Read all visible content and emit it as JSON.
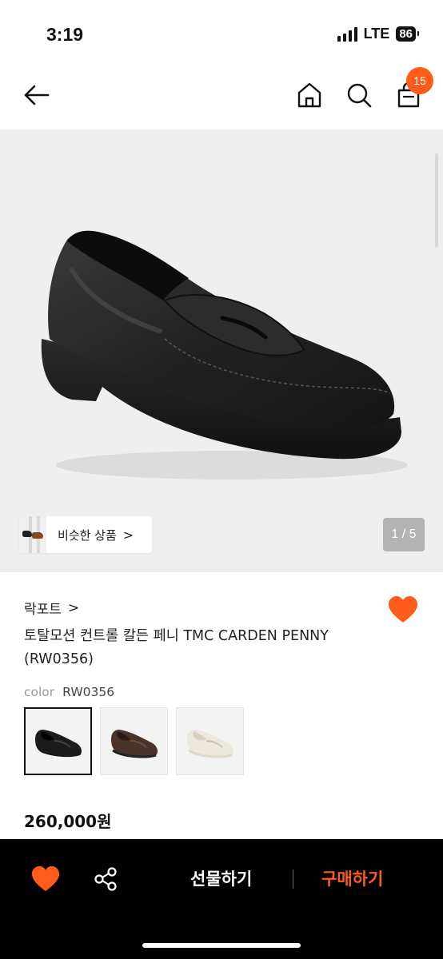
{
  "status_bar": {
    "time": "3:19",
    "network": "LTE",
    "battery": "86"
  },
  "header": {
    "icons": [
      "back-arrow-icon",
      "home-icon",
      "search-icon",
      "shopping-bag-icon"
    ],
    "cart_count": "15"
  },
  "gallery": {
    "similar_label": "비슷한 상품",
    "similar_chevron": ">",
    "counter": "1 / 5"
  },
  "product": {
    "brand": "락포트",
    "brand_chevron": ">",
    "title": "토탈모션 컨트롤 칼든 페니 TMC CARDEN PENNY (RW0356)",
    "color_label": "color",
    "color_value": "RW0356",
    "swatches": [
      "black",
      "brown",
      "white"
    ],
    "price": "260,000원"
  },
  "bottom_bar": {
    "gift_label": "선물하기",
    "buy_label": "구매하기"
  },
  "colors": {
    "accent": "#ff5b1a",
    "bottom_bar_bg": "#000000",
    "image_bg": "#efefef"
  }
}
